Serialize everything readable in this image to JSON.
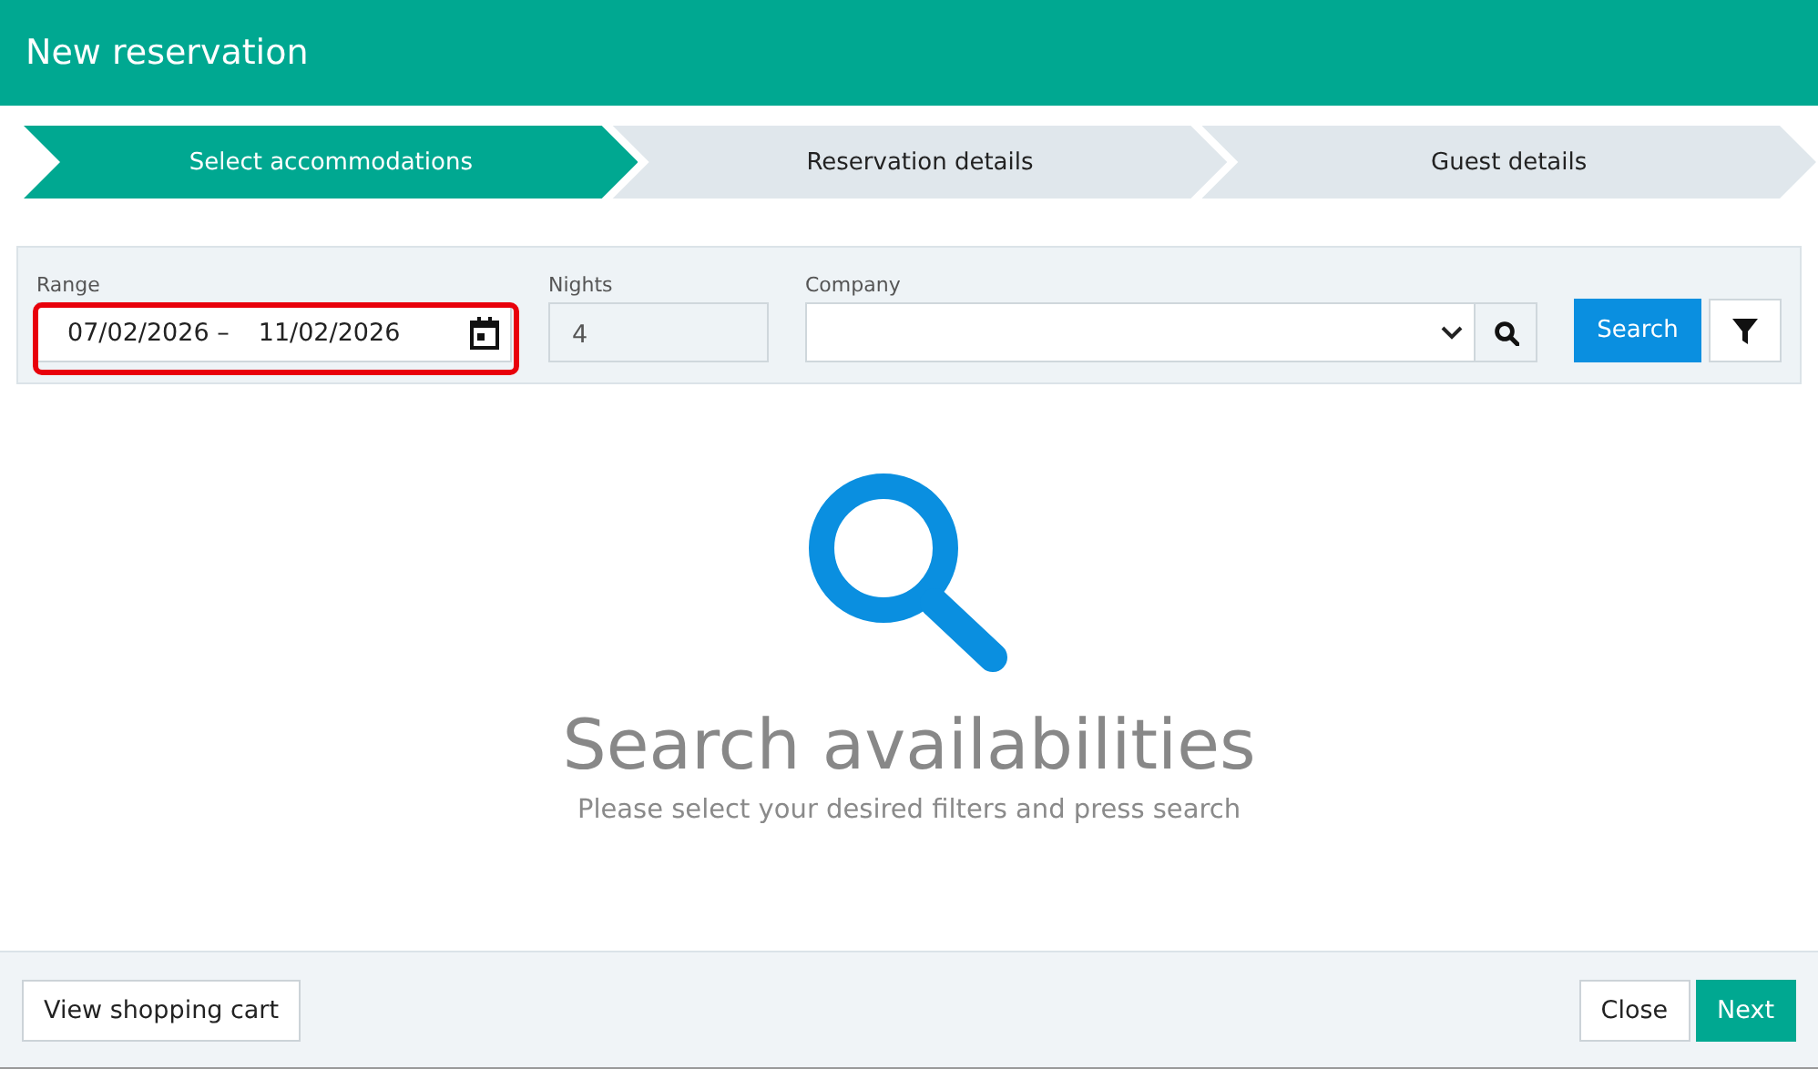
{
  "window": {
    "title": "New reservation"
  },
  "steps": [
    {
      "label": "Select accommodations",
      "selected": true
    },
    {
      "label": "Reservation details",
      "selected": false
    },
    {
      "label": "Guest details",
      "selected": false
    }
  ],
  "filters": {
    "range": {
      "label": "Range",
      "start": "07/02/2026",
      "separator": "–",
      "end": "11/02/2026",
      "highlighted": true
    },
    "nights": {
      "label": "Nights",
      "value": "4"
    },
    "company": {
      "label": "Company"
    },
    "search_button": "Search"
  },
  "empty_state": {
    "title": "Search availabilities",
    "message": "Please select your desired filters and press search"
  },
  "footer": {
    "left_button": "View shopping cart",
    "buttons": [
      {
        "label": "Close",
        "kind": "secondary"
      },
      {
        "label": "Next",
        "kind": "primary"
      }
    ]
  }
}
